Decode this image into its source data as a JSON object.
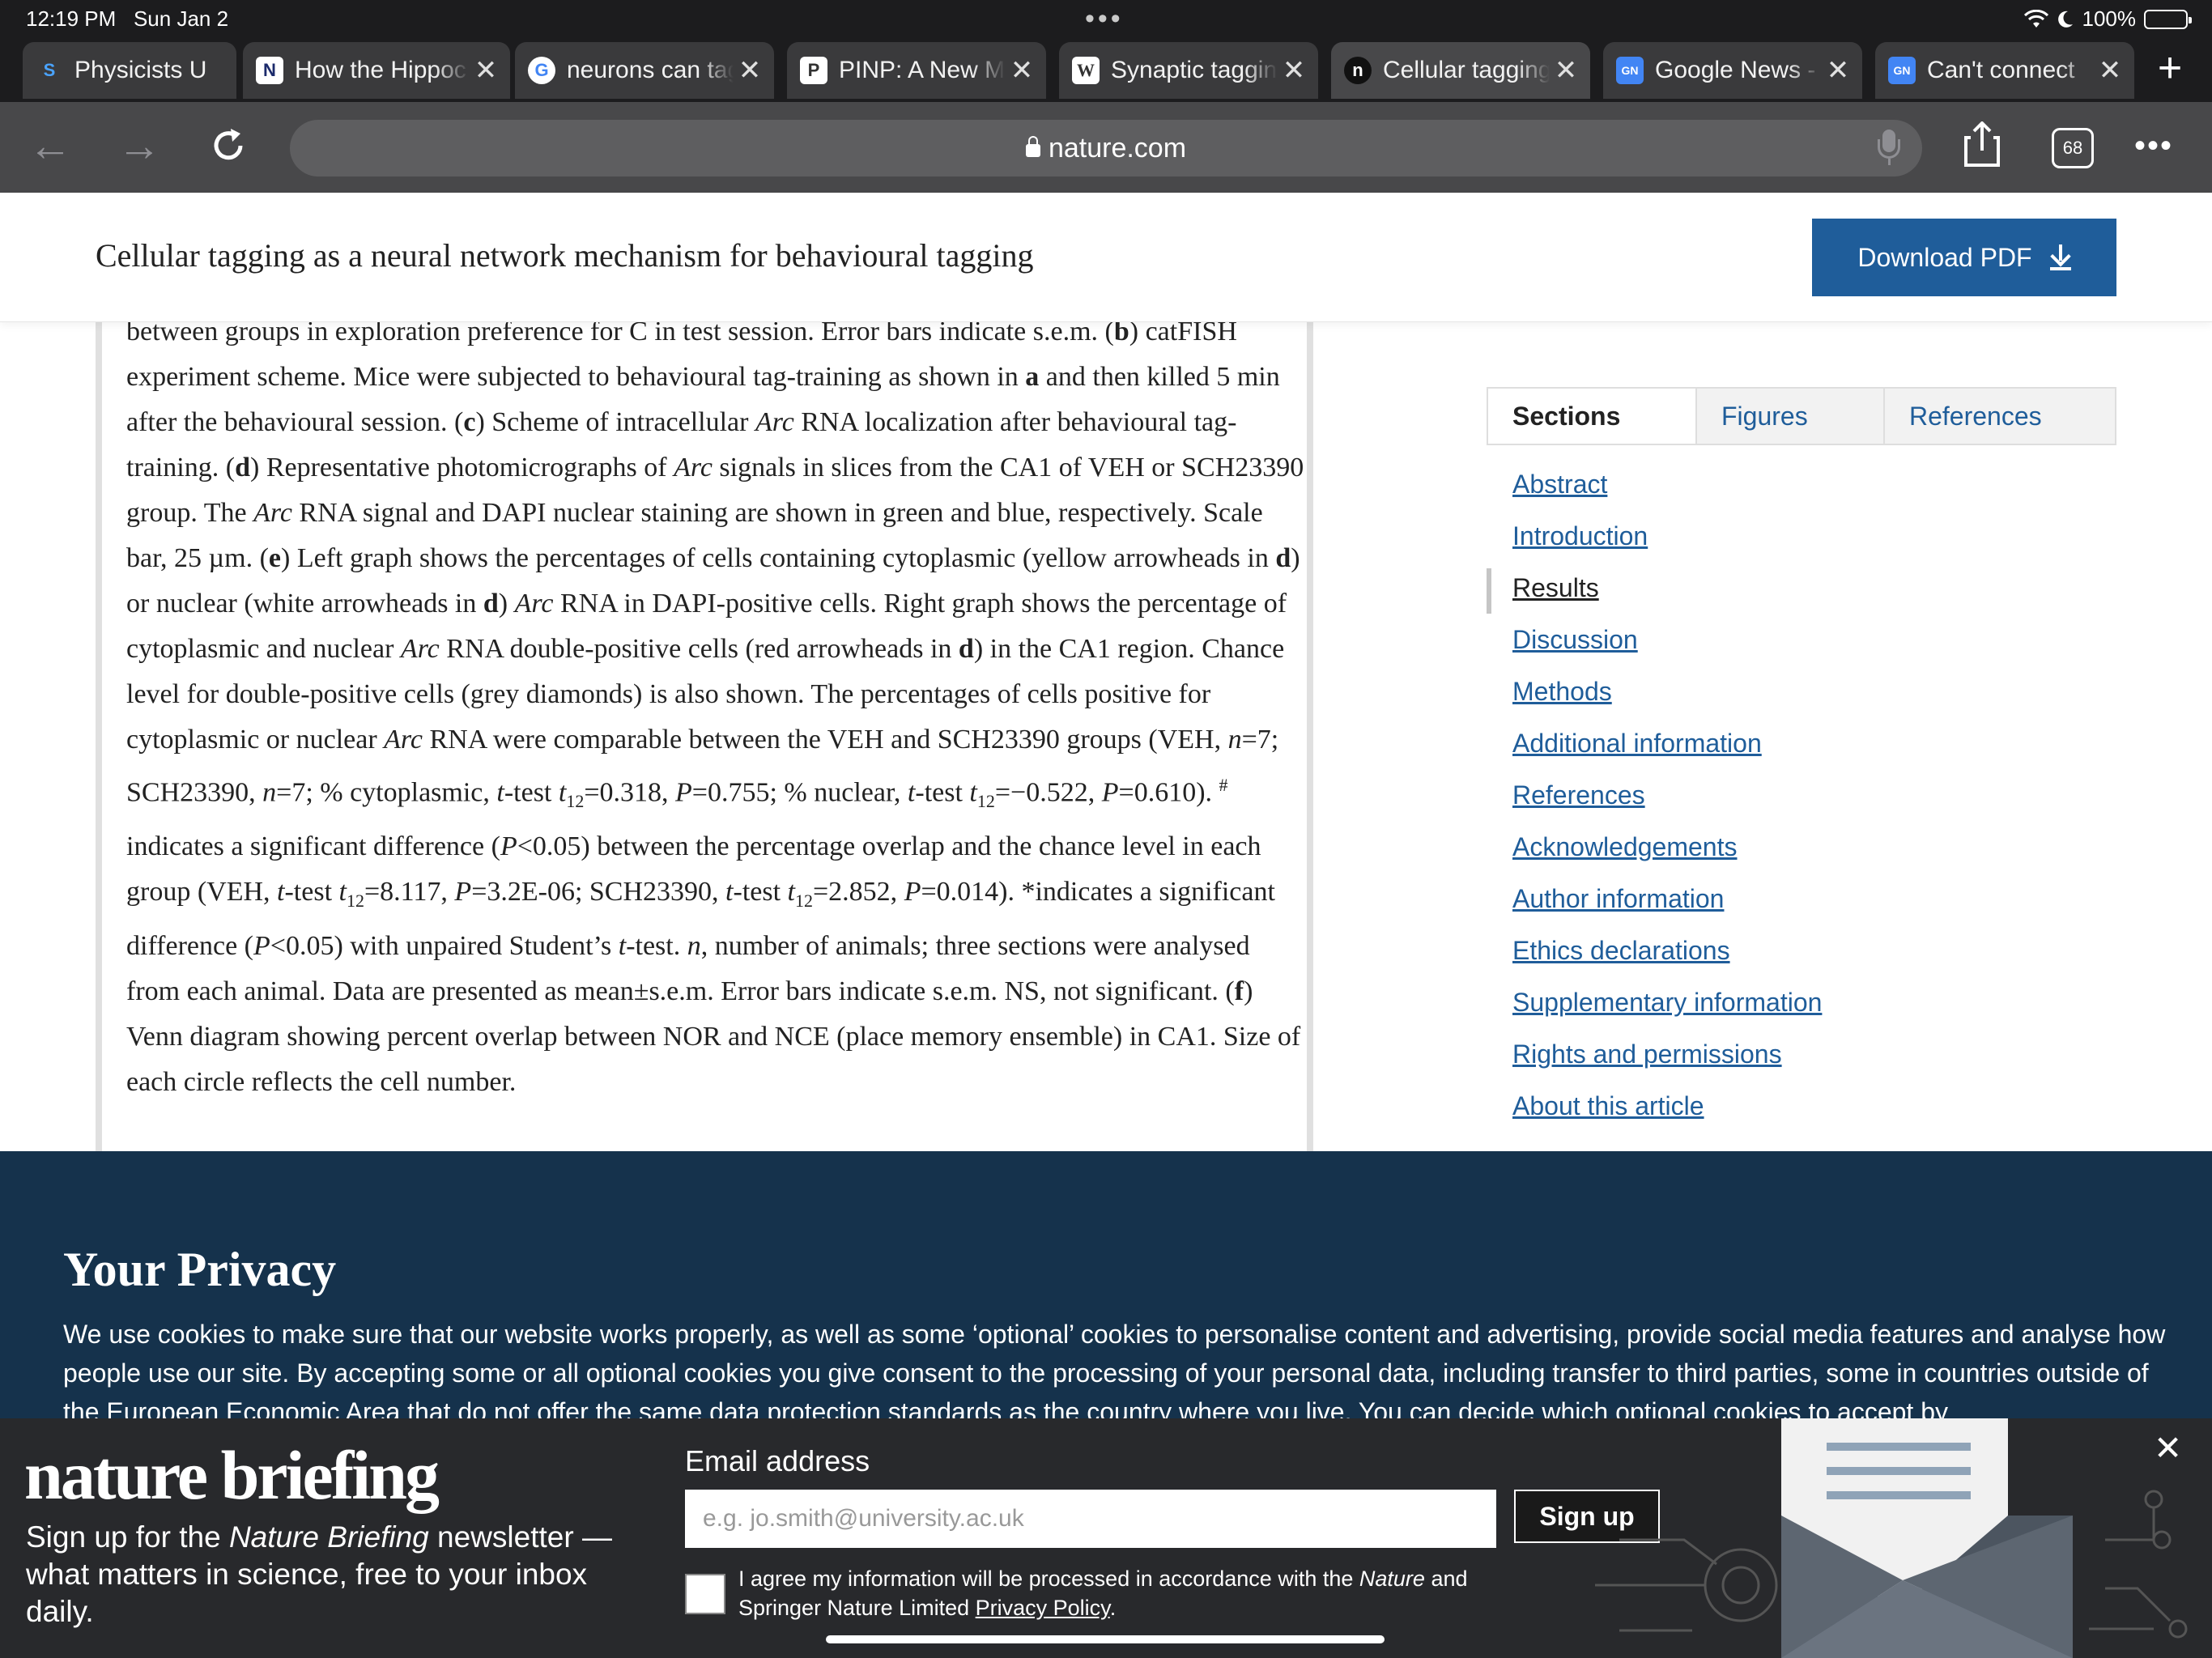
{
  "status": {
    "time": "12:19 PM",
    "date": "Sun Jan 2",
    "battery": "100%"
  },
  "tabs": [
    {
      "title": "Physicists U",
      "favicon": "S"
    },
    {
      "title": "How the Hippoc",
      "favicon": "N"
    },
    {
      "title": "neurons can tag",
      "favicon": "G"
    },
    {
      "title": "PINP: A New M",
      "favicon": "P"
    },
    {
      "title": "Synaptic tagging",
      "favicon": "W"
    },
    {
      "title": "Cellular tagging",
      "favicon": "n"
    },
    {
      "title": "Google News -",
      "favicon": "GN"
    },
    {
      "title": "Can't connect",
      "favicon": "GN"
    }
  ],
  "toolbar": {
    "address": "nature.com",
    "tab_count": "68"
  },
  "article": {
    "title": "Cellular tagging as a neural network mechanism for behavioural tagging",
    "download_label": "Download PDF"
  },
  "sections_panel": {
    "tabs": [
      "Sections",
      "Figures",
      "References"
    ],
    "items": [
      "Abstract",
      "Introduction",
      "Results",
      "Discussion",
      "Methods",
      "Additional information",
      "References",
      "Acknowledgements",
      "Author information",
      "Ethics declarations",
      "Supplementary information",
      "Rights and permissions",
      "About this article"
    ]
  },
  "privacy": {
    "heading": "Your Privacy",
    "text": "We use cookies to make sure that our website works properly, as well as some ‘optional’ cookies to personalise content and advertising, provide social media features and analyse how people use our site. By accepting some or all optional cookies you give consent to the processing of your personal data, including transfer to third parties, some in countries outside of the European Economic Area that do not offer the same data protection standards as the country where you live. You can decide which optional cookies to accept by"
  },
  "briefing": {
    "brand": "nature briefing",
    "blurb_pre": "Sign up for the ",
    "blurb_em": "Nature Briefing",
    "blurb_post": " newsletter — what matters in science, free to your inbox daily.",
    "email_label": "Email address",
    "email_placeholder": "e.g. jo.smith@university.ac.uk",
    "signup_label": "Sign up",
    "consent_pre": "I agree my information will be processed in accordance with the ",
    "consent_em": "Nature",
    "consent_mid": " and Springer Nature Limited ",
    "consent_link": "Privacy Policy",
    "consent_post": "."
  },
  "caption": {
    "t1": "between groups in exploration preference for C in test session. Error bars indicate s.e.m. (",
    "b": "b",
    "t2": ") catFISH experiment scheme. Mice were subjected to behavioural tag-training as shown in ",
    "a": "a",
    "t3": " and then killed 5 min after the behavioural session. (",
    "c": "c",
    "t4": ") Scheme of intracellular ",
    "arc": "Arc",
    "t5": " RNA localization after behavioural tag-training. (",
    "d": "d",
    "t6": ") Representative photomicrographs of ",
    "t7": " signals in slices from the CA1 of VEH or SCH23390 group. The ",
    "t8": " RNA signal and DAPI nuclear staining are shown in green and blue, respectively. Scale bar, 25 µm. (",
    "e": "e",
    "t9": ") Left graph shows the percentages of cells containing cytoplasmic (yellow arrowheads in ",
    "t10": ") or nuclear (white arrowheads in ",
    "t11": ") ",
    "t12": " RNA in DAPI-positive cells. Right graph shows the percentage of cytoplasmic and nuclear ",
    "t13": " RNA double-positive cells (red arrowheads in ",
    "t14": ") in the CA1 region. Chance level for double-positive cells (grey diamonds) is also shown. The percentages of cells positive for cytoplasmic or nuclear ",
    "t15": " RNA were comparable between the VEH and SCH23390 groups (VEH, ",
    "n": "n",
    "t16": "=7; SCH23390, ",
    "t17": "=7; % cytoplasmic, ",
    "t": "t",
    "t18": "-test ",
    "sub12": "12",
    "t19": "=0.318, ",
    "P": "P",
    "t20": "=0.755; % nuclear, ",
    "t21": "=−0.522, ",
    "t22": "=0.610). ",
    "hash": "#",
    "t23": " indicates a significant difference (",
    "t24": "<0.05) between the percentage overlap and the chance level in each group (VEH, ",
    "t25": "=8.117, ",
    "t26": "=3.2E-06; SCH23390, ",
    "t27": "=2.852, ",
    "t28": "=0.014). *indicates a significant difference (",
    "t29": "<0.05) with unpaired Student’s ",
    "t30": "-test. ",
    "t31": ", number of animals; three sections were analysed from each animal. Data are presented as mean±s.e.m. Error bars indicate s.e.m. NS, not significant. (",
    "f": "f",
    "t32": ") Venn diagram showing percent overlap between NOR and NCE (place memory ensemble) in CA1. Size of each circle reflects the cell number."
  },
  "colors": {
    "accent": "#1f5d9a",
    "privacy_bg": "#15324c",
    "briefing_bg": "#28292c"
  }
}
